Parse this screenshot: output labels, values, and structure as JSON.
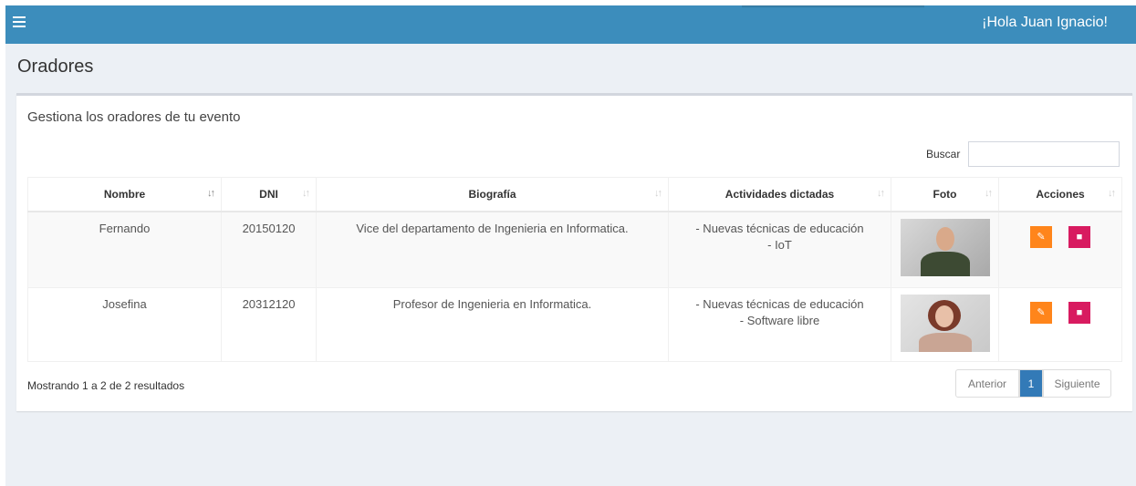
{
  "header": {
    "greeting": "¡Hola Juan Ignacio!"
  },
  "page": {
    "title": "Oradores",
    "subtitle": "Gestiona los oradores de tu evento"
  },
  "search": {
    "label": "Buscar",
    "value": ""
  },
  "table": {
    "columns": [
      "Nombre",
      "DNI",
      "Biografía",
      "Actividades dictadas",
      "Foto",
      "Acciones"
    ],
    "rows": [
      {
        "nombre": "Fernando",
        "dni": "20150120",
        "biografia": "Vice del departamento de Ingenieria en Informatica.",
        "actividades": [
          "- Nuevas técnicas de educación",
          "- IoT"
        ]
      },
      {
        "nombre": "Josefina",
        "dni": "20312120",
        "biografia": "Profesor de Ingenieria en Informatica.",
        "actividades": [
          "- Nuevas técnicas de educación",
          "- Software libre"
        ]
      }
    ]
  },
  "footer": {
    "info": "Mostrando 1 a 2 de 2 resultados",
    "pagination": {
      "prev": "Anterior",
      "current": "1",
      "next": "Siguiente"
    }
  },
  "colors": {
    "topbar": "#3c8dbc",
    "edit": "#ff851b",
    "delete": "#d81b60",
    "page_active": "#337ab7"
  }
}
